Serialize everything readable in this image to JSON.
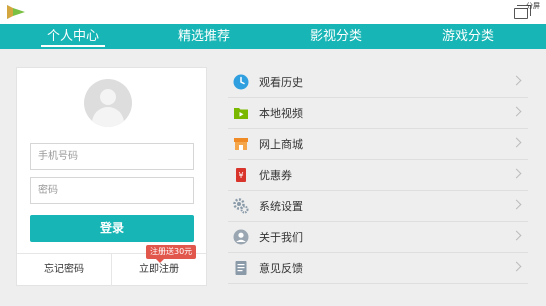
{
  "header": {
    "split_label": "分屏"
  },
  "tabs": [
    {
      "label": "个人中心",
      "active": true
    },
    {
      "label": "精选推荐",
      "active": false
    },
    {
      "label": "影视分类",
      "active": false
    },
    {
      "label": "游戏分类",
      "active": false
    }
  ],
  "login": {
    "phone_placeholder": "手机号码",
    "password_placeholder": "密码",
    "login_label": "登录",
    "forgot_label": "忘记密码",
    "register_label": "立即注册",
    "promo_badge": "注册送30元"
  },
  "menu": [
    {
      "label": "观看历史",
      "icon": "clock-icon"
    },
    {
      "label": "本地视频",
      "icon": "video-folder-icon"
    },
    {
      "label": "网上商城",
      "icon": "store-icon"
    },
    {
      "label": "优惠券",
      "icon": "coupon-icon"
    },
    {
      "label": "系统设置",
      "icon": "gear-icon"
    },
    {
      "label": "关于我们",
      "icon": "user-icon"
    },
    {
      "label": "意见反馈",
      "icon": "feedback-icon"
    }
  ],
  "colors": {
    "accent": "#17b5b5",
    "promo": "#e2574c",
    "background": "#eeeeee"
  }
}
